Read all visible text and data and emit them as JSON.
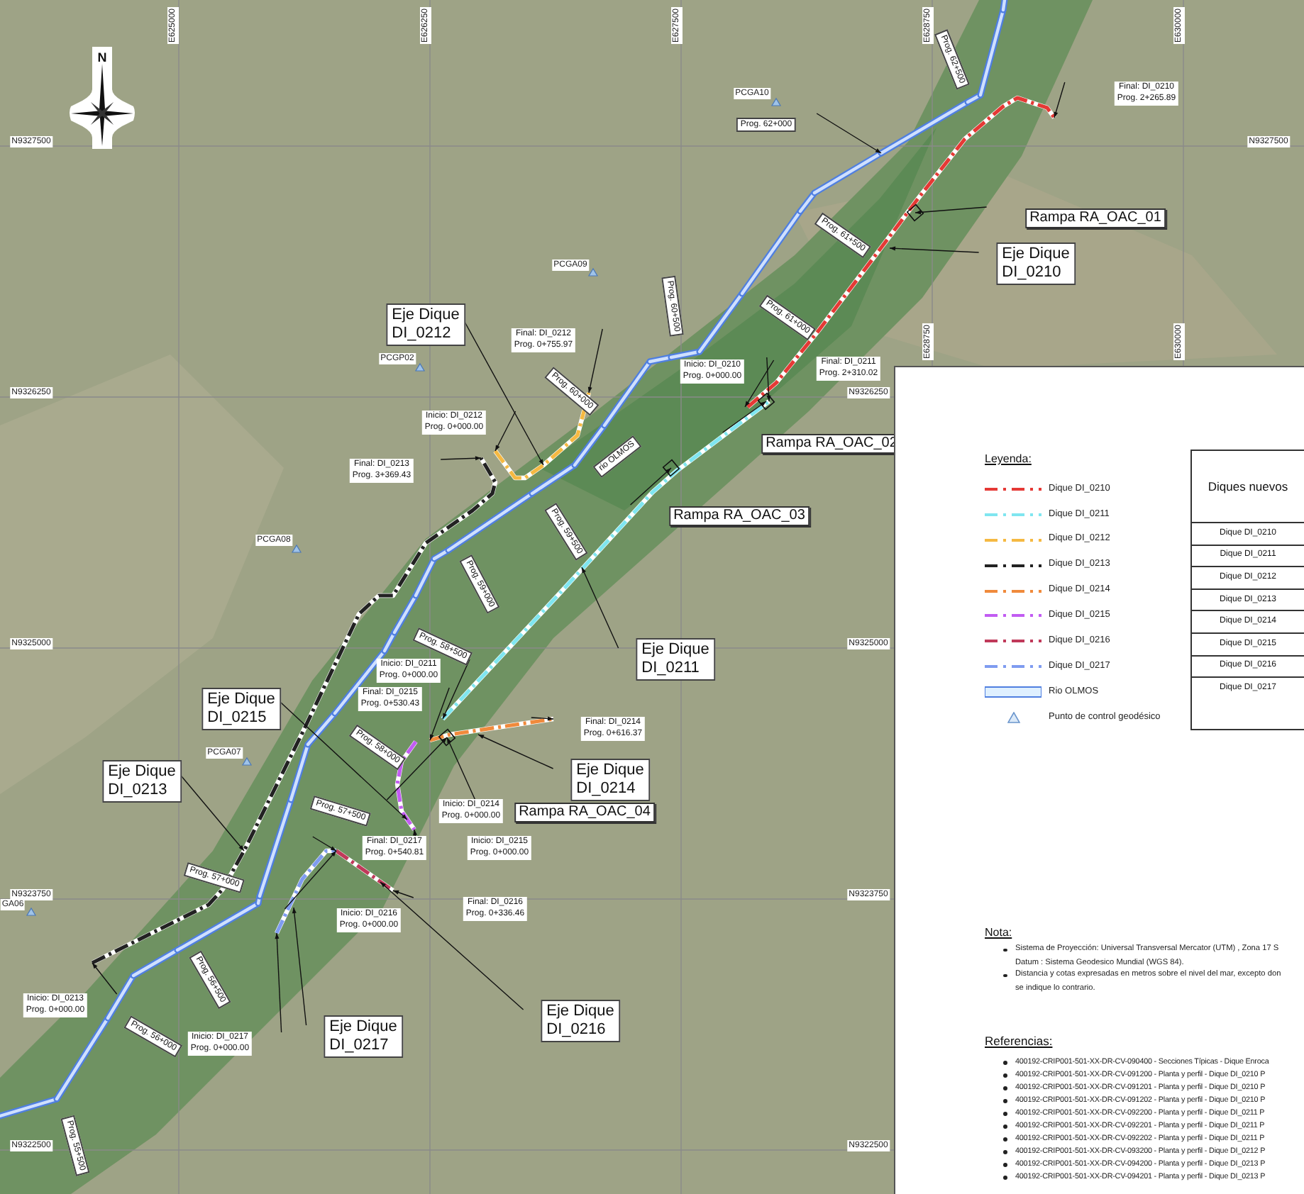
{
  "map": {
    "north_arrow": {
      "label": "N"
    },
    "grid_labels": [
      {
        "text": "E625000",
        "kind": "easting"
      },
      {
        "text": "E626250",
        "kind": "easting"
      },
      {
        "text": "E627500",
        "kind": "easting"
      },
      {
        "text": "E628750",
        "kind": "easting"
      },
      {
        "text": "E630000",
        "kind": "easting"
      },
      {
        "text": "E628750",
        "kind": "easting"
      },
      {
        "text": "E630000",
        "kind": "easting"
      },
      {
        "text": "N9327500",
        "kind": "northing"
      },
      {
        "text": "N9327500",
        "kind": "northing"
      },
      {
        "text": "N9326250",
        "kind": "northing"
      },
      {
        "text": "N9326250",
        "kind": "northing"
      },
      {
        "text": "N9325000",
        "kind": "northing"
      },
      {
        "text": "N9325000",
        "kind": "northing"
      },
      {
        "text": "N9323750",
        "kind": "northing"
      },
      {
        "text": "N9323750",
        "kind": "northing"
      },
      {
        "text": "N9322500",
        "kind": "northing"
      },
      {
        "text": "N9322500",
        "kind": "northing"
      }
    ],
    "control_points": [
      {
        "label": "PCGA10"
      },
      {
        "label": "PCGA09"
      },
      {
        "label": "PCGP02"
      },
      {
        "label": "PCGA08"
      },
      {
        "label": "PCGA07"
      },
      {
        "label": "GA06"
      }
    ],
    "chainage_labels": [
      {
        "text": "Prog. 62+500"
      },
      {
        "text": "Prog. 62+000"
      },
      {
        "text": "Prog. 61+500"
      },
      {
        "text": "Prog. 61+000"
      },
      {
        "text": "Prog. 60+500"
      },
      {
        "text": "Prog. 60+000"
      },
      {
        "text": "Prog. 59+500"
      },
      {
        "text": "Prog. 59+000"
      },
      {
        "text": "Prog. 58+500"
      },
      {
        "text": "Prog. 58+000"
      },
      {
        "text": "Prog. 57+500"
      },
      {
        "text": "Prog. 57+000"
      },
      {
        "text": "Prog. 56+500"
      },
      {
        "text": "Prog. 56+000"
      },
      {
        "text": "Prog. 55+500"
      }
    ],
    "river_label": {
      "text": "rio OLMOS"
    },
    "endpoint_labels": [
      {
        "lines": [
          "Final: DI_0210",
          "Prog. 2+265.89"
        ]
      },
      {
        "lines": [
          "Final: DI_0212",
          "Prog. 0+755.97"
        ]
      },
      {
        "lines": [
          "Inicio: DI_0212",
          "Prog. 0+000.00"
        ]
      },
      {
        "lines": [
          "Final: DI_0213",
          "Prog. 3+369.43"
        ]
      },
      {
        "lines": [
          "Inicio: DI_0210",
          "Prog. 0+000.00"
        ]
      },
      {
        "lines": [
          "Final: DI_0211",
          "Prog. 2+310.02"
        ]
      },
      {
        "lines": [
          "Inicio: DI_0211",
          "Prog. 0+000.00"
        ]
      },
      {
        "lines": [
          "Final: DI_0215",
          "Prog. 0+530.43"
        ]
      },
      {
        "lines": [
          "Final: DI_0214",
          "Prog. 0+616.37"
        ]
      },
      {
        "lines": [
          "Inicio: DI_0214",
          "Prog. 0+000.00"
        ]
      },
      {
        "lines": [
          "Final: DI_0217",
          "Prog. 0+540.81"
        ]
      },
      {
        "lines": [
          "Inicio: DI_0215",
          "Prog. 0+000.00"
        ]
      },
      {
        "lines": [
          "Inicio: DI_0216",
          "Prog. 0+000.00"
        ]
      },
      {
        "lines": [
          "Final: DI_0216",
          "Prog. 0+336.46"
        ]
      },
      {
        "lines": [
          "Inicio: DI_0213",
          "Prog. 0+000.00"
        ]
      },
      {
        "lines": [
          "Inicio: DI_0217",
          "Prog. 0+000.00"
        ]
      }
    ],
    "dike_labels": [
      {
        "lines": [
          "Eje Dique",
          "DI_0212"
        ]
      },
      {
        "lines": [
          "Eje Dique",
          "DI_0210"
        ]
      },
      {
        "lines": [
          "Eje Dique",
          "DI_0211"
        ]
      },
      {
        "lines": [
          "Eje Dique",
          "DI_0215"
        ]
      },
      {
        "lines": [
          "Eje Dique",
          "DI_0213"
        ]
      },
      {
        "lines": [
          "Eje Dique",
          "DI_0214"
        ]
      },
      {
        "lines": [
          "Eje Dique",
          "DI_0216"
        ]
      },
      {
        "lines": [
          "Eje Dique",
          "DI_0217"
        ]
      }
    ],
    "ramp_labels": [
      {
        "text": "Rampa RA_OAC_01"
      },
      {
        "text": "Rampa RA_OAC_02"
      },
      {
        "text": "Rampa RA_OAC_03"
      },
      {
        "text": "Rampa RA_OAC_04"
      }
    ]
  },
  "legend": {
    "title": "Leyenda:",
    "items": [
      {
        "label": "Dique DI_0210",
        "kind": "dike",
        "color": "#e53935"
      },
      {
        "label": "Dique DI_0211",
        "kind": "dike",
        "color": "#7fe6f0"
      },
      {
        "label": "Dique DI_0212",
        "kind": "dike",
        "color": "#f5b942"
      },
      {
        "label": "Dique DI_0213",
        "kind": "dike",
        "color": "#222222"
      },
      {
        "label": "Dique DI_0214",
        "kind": "dike",
        "color": "#f08a3c"
      },
      {
        "label": "Dique DI_0215",
        "kind": "dike",
        "color": "#c25cf2"
      },
      {
        "label": "Dique DI_0216",
        "kind": "dike",
        "color": "#c0395a"
      },
      {
        "label": "Dique DI_0217",
        "kind": "dike",
        "color": "#7f9cf0"
      },
      {
        "label": "Rio OLMOS",
        "kind": "river"
      },
      {
        "label": "Punto de control geodésico",
        "kind": "control-point"
      }
    ]
  },
  "table": {
    "header": "Diques nuevos",
    "rows": [
      "Dique DI_0210",
      "Dique DI_0211",
      "Dique DI_0212",
      "Dique DI_0213",
      "Dique DI_0214",
      "Dique DI_0215",
      "Dique DI_0216",
      "Dique DI_0217"
    ]
  },
  "notes": {
    "title": "Nota:",
    "items": [
      {
        "lines": [
          "Sistema de Proyección: Universal Transversal Mercator (UTM) , Zona 17 S",
          "Datum : Sistema Geodesico Mundial (WGS 84)."
        ]
      },
      {
        "lines": [
          "Distancia y cotas expresadas en metros sobre el nivel del mar, excepto don",
          "se indique lo contrario."
        ]
      }
    ]
  },
  "references": {
    "title": "Referencias:",
    "items": [
      "400192-CRIP001-501-XX-DR-CV-090400 - Secciones Típicas - Dique Enroca",
      "400192-CRIP001-501-XX-DR-CV-091200 - Planta y perfil - Dique DI_0210 P",
      "400192-CRIP001-501-XX-DR-CV-091201 - Planta y perfil - Dique DI_0210 P",
      "400192-CRIP001-501-XX-DR-CV-091202 - Planta y perfil - Dique DI_0210 P",
      "400192-CRIP001-501-XX-DR-CV-092200 - Planta y perfil - Dique DI_0211 P",
      "400192-CRIP001-501-XX-DR-CV-092201 - Planta y perfil - Dique DI_0211 P",
      "400192-CRIP001-501-XX-DR-CV-092202 - Planta y perfil - Dique DI_0211 P",
      "400192-CRIP001-501-XX-DR-CV-093200 - Planta y perfil - Dique DI_0212 P",
      "400192-CRIP001-501-XX-DR-CV-094200 - Planta y perfil - Dique DI_0213 P",
      "400192-CRIP001-501-XX-DR-CV-094201 - Planta y perfil - Dique DI_0213 P"
    ]
  }
}
